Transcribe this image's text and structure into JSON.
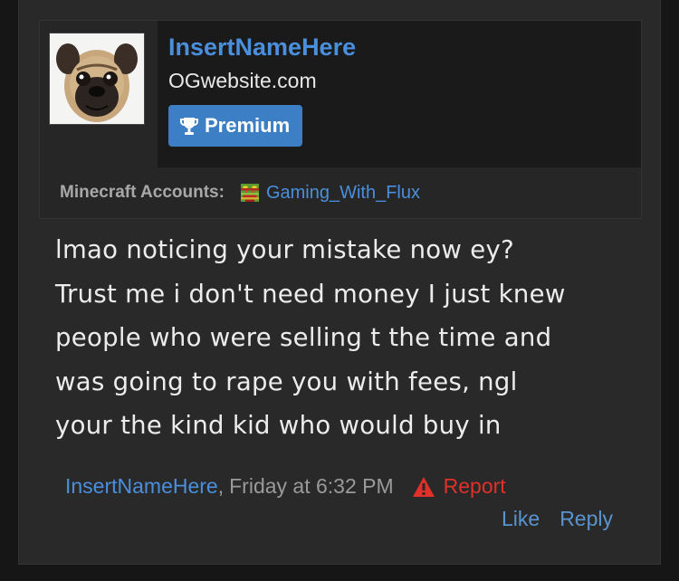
{
  "user": {
    "name": "InsertNameHere",
    "site": "OGwebsite.com",
    "badge_label": "Premium",
    "badge_icon": "trophy-icon",
    "avatar_icon": "pug-avatar"
  },
  "minecraft": {
    "label": "Minecraft Accounts:",
    "account_name": "Gaming_With_Flux",
    "skin_icon": "minecraft-skin-icon"
  },
  "post": {
    "lines": [
      "lmao noticing your mistake now ey?",
      "Trust me i don't need money I just knew",
      "people who were selling t the time and",
      "was going to rape you with fees, ngl",
      "your the kind kid who would buy in"
    ]
  },
  "footer": {
    "author": "InsertNameHere",
    "separator": ",",
    "timestamp": "Friday at 6:32 PM",
    "report_label": "Report",
    "like_label": "Like",
    "reply_label": "Reply"
  },
  "colors": {
    "background": "#292929",
    "accent": "#4a8fdd",
    "badge": "#3d7fc4",
    "report": "#e0302a"
  }
}
